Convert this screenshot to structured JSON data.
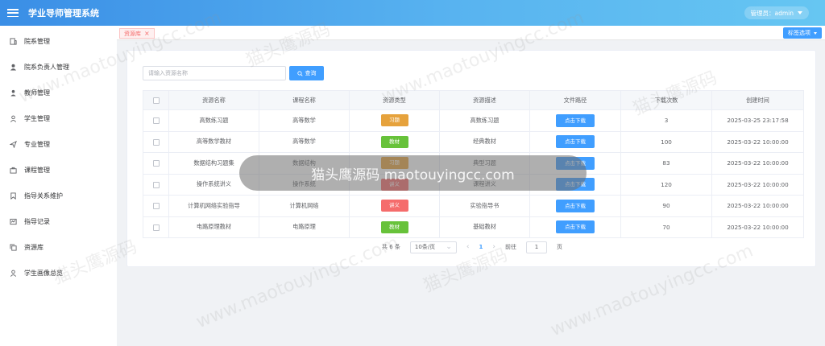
{
  "header": {
    "app_title": "学业导师管理系统",
    "user_label": "管理员：admin"
  },
  "sidebar": {
    "items": [
      {
        "label": "院系管理",
        "icon": "building-icon"
      },
      {
        "label": "院系负责人管理",
        "icon": "user-icon"
      },
      {
        "label": "教师管理",
        "icon": "teacher-icon"
      },
      {
        "label": "学生管理",
        "icon": "student-icon"
      },
      {
        "label": "专业管理",
        "icon": "send-icon"
      },
      {
        "label": "课程管理",
        "icon": "briefcase-icon"
      },
      {
        "label": "指导关系维护",
        "icon": "bookmark-icon"
      },
      {
        "label": "指导记录",
        "icon": "record-icon"
      },
      {
        "label": "资源库",
        "icon": "copy-icon"
      },
      {
        "label": "学生画像总览",
        "icon": "profile-icon"
      }
    ]
  },
  "tagbar": {
    "active_tag": "资源库",
    "options_label": "标签选项"
  },
  "search": {
    "placeholder": "请输入资源名称",
    "button_label": "查询"
  },
  "table": {
    "columns": [
      "资源名称",
      "课程名称",
      "资源类型",
      "资源描述",
      "文件路径",
      "下载次数",
      "创建时间"
    ],
    "download_label": "点击下载",
    "rows": [
      {
        "name": "高数练习题",
        "course": "高等数学",
        "type": "习题",
        "desc": "高数练习题",
        "downloads": "3",
        "created": "2025-03-25 23:17:58"
      },
      {
        "name": "高等数学教材",
        "course": "高等数学",
        "type": "教材",
        "desc": "经典教材",
        "downloads": "100",
        "created": "2025-03-22 10:00:00"
      },
      {
        "name": "数据结构习题集",
        "course": "数据结构",
        "type": "习题",
        "desc": "典型习题",
        "downloads": "83",
        "created": "2025-03-22 10:00:00"
      },
      {
        "name": "操作系统讲义",
        "course": "操作系统",
        "type": "讲义",
        "desc": "课程讲义",
        "downloads": "120",
        "created": "2025-03-22 10:00:00"
      },
      {
        "name": "计算机网络实验指导",
        "course": "计算机网络",
        "type": "讲义",
        "desc": "实验指导书",
        "downloads": "90",
        "created": "2025-03-22 10:00:00"
      },
      {
        "name": "电路原理教材",
        "course": "电路原理",
        "type": "教材",
        "desc": "基础教材",
        "downloads": "70",
        "created": "2025-03-22 10:00:00"
      }
    ]
  },
  "type_colors": {
    "习题": "#e6a23c",
    "教材": "#67c23a",
    "讲义": "#f56c6c"
  },
  "pagination": {
    "total_label": "共 6 条",
    "page_size": "10条/页",
    "current_page": "1",
    "goto_label": "前往",
    "goto_value": "1",
    "page_suffix": "页"
  },
  "watermark": {
    "pill_text": "猫头鹰源码 maotouyingcc.com",
    "text_cn": "猫头鹰源码",
    "text_en": "www.maotouyingcc.com"
  }
}
